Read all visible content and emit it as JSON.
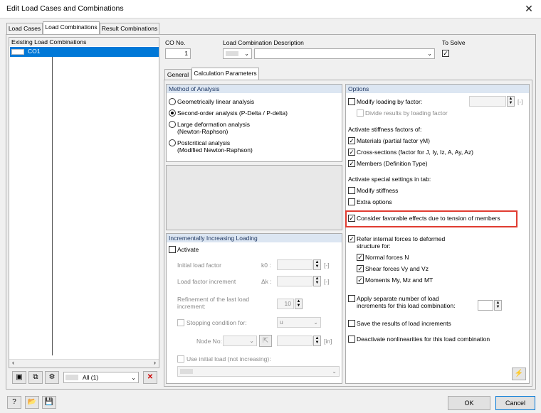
{
  "window": {
    "title": "Edit Load Cases and Combinations",
    "close_glyph": "✕"
  },
  "tabs": [
    "Load Cases",
    "Load Combinations",
    "Result Combinations"
  ],
  "left": {
    "header": "Existing Load Combinations",
    "items": [
      {
        "label": "CO1"
      }
    ],
    "filter_value": "All (1)"
  },
  "co": {
    "no_label": "CO No.",
    "no_value": "1",
    "desc_label": "Load Combination Description",
    "to_solve_label": "To Solve",
    "to_solve_checked": true
  },
  "subtabs": [
    "General",
    "Calculation Parameters"
  ],
  "method": {
    "header": "Method of Analysis",
    "options": [
      {
        "label": "Geometrically linear analysis",
        "selected": false
      },
      {
        "label": "Second-order analysis (P-Delta / P-delta)",
        "selected": true
      },
      {
        "label": "Large deformation analysis",
        "label2": "(Newton-Raphson)",
        "selected": false
      },
      {
        "label": "Postcritical analysis",
        "label2": "(Modified Newton-Raphson)",
        "selected": false
      }
    ]
  },
  "incremental": {
    "header": "Incrementally Increasing Loading",
    "activate_label": "Activate",
    "initial_factor_label": "Initial load factor",
    "initial_factor_symbol": "k0 :",
    "factor_increment_label": "Load factor increment",
    "factor_increment_symbol": "Δk :",
    "unit": "[-]",
    "refinement_label1": "Refinement of the last load",
    "refinement_label2": "increment:",
    "refinement_value": "10",
    "stopping_label": "Stopping condition for:",
    "stopping_value": "u",
    "node_label": "Node No:",
    "node_unit": "[in]",
    "use_initial_label": "Use initial load (not increasing):"
  },
  "options": {
    "header": "Options",
    "modify_loading": "Modify loading by factor:",
    "modify_unit": "[-]",
    "divide_results": "Divide results by loading factor",
    "stiffness_header": "Activate stiffness factors of:",
    "materials": "Materials (partial factor γM)",
    "cross_sections": "Cross-sections (factor for J, Iy, Iz, A, Ay, Az)",
    "members": "Members (Definition Type)",
    "special_header": "Activate special settings in tab:",
    "modify_stiffness": "Modify stiffness",
    "extra_options": "Extra options",
    "favorable": "Consider favorable effects due to tension of members",
    "refer_forces1": "Refer internal forces to deformed",
    "refer_forces2": "structure for:",
    "normal_forces": "Normal forces N",
    "shear_forces": "Shear forces Vy and Vz",
    "moments": "Moments My, Mz and MT",
    "apply_separate1": "Apply separate number of load",
    "apply_separate2": "increments for this load combination:",
    "save_results": "Save the results of load increments",
    "deactivate": "Deactivate nonlinearities for this load combination"
  },
  "buttons": {
    "ok": "OK",
    "cancel": "Cancel"
  },
  "colors": {
    "selection": "#0078d7",
    "highlight": "#e03c31",
    "group_header": "#dce6f2"
  }
}
